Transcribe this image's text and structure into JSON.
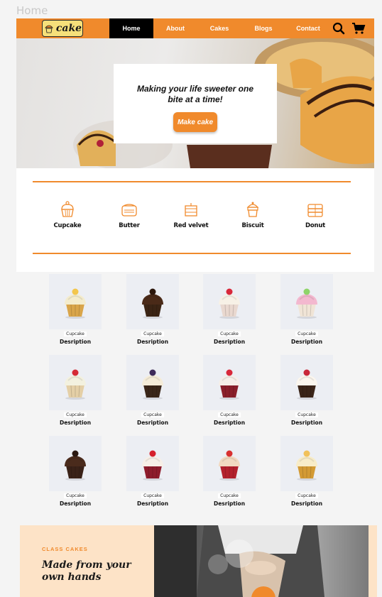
{
  "page_label": "Home",
  "brand": {
    "logo_text": "cake"
  },
  "nav": {
    "items": [
      {
        "label": "Home",
        "active": true
      },
      {
        "label": "About",
        "active": false
      },
      {
        "label": "Cakes",
        "active": false
      },
      {
        "label": "Blogs",
        "active": false
      },
      {
        "label": "Contact",
        "active": false
      }
    ],
    "icons": [
      "search-icon",
      "cart-icon"
    ]
  },
  "hero": {
    "title": "Making your life sweeter one bite at a time!",
    "button_label": "Make cake"
  },
  "categories": [
    {
      "label": "Cupcake",
      "icon": "cupcake-icon"
    },
    {
      "label": "Butter",
      "icon": "butter-icon"
    },
    {
      "label": "Red velvet",
      "icon": "red-velvet-icon"
    },
    {
      "label": "Biscuit",
      "icon": "biscuit-icon"
    },
    {
      "label": "Donut",
      "icon": "donut-icon"
    }
  ],
  "products": [
    {
      "name": "Cupcake",
      "desc": "Desription",
      "frosting": "#f4eccd",
      "wrapper": "#d9a54a",
      "topping": "#f3c64c"
    },
    {
      "name": "Cupcake",
      "desc": "Desription",
      "frosting": "#4a2a18",
      "wrapper": "#3b2414",
      "topping": "#2c170c"
    },
    {
      "name": "Cupcake",
      "desc": "Desription",
      "frosting": "#f7f1e6",
      "wrapper": "#e9d8cf",
      "topping": "#d8283a"
    },
    {
      "name": "Cupcake",
      "desc": "Desription",
      "frosting": "#f3b8cf",
      "wrapper": "#f0e4d6",
      "topping": "#8fd46a"
    },
    {
      "name": "Cupcake",
      "desc": "Desription",
      "frosting": "#f3f1df",
      "wrapper": "#e4cfa6",
      "topping": "#d52b36"
    },
    {
      "name": "Cupcake",
      "desc": "Desription",
      "frosting": "#f5ecd8",
      "wrapper": "#3a2618",
      "topping": "#3e2b5a"
    },
    {
      "name": "Cupcake",
      "desc": "Desription",
      "frosting": "#f6efe8",
      "wrapper": "#8a1f2a",
      "topping": "#d8283a"
    },
    {
      "name": "Cupcake",
      "desc": "Desription",
      "frosting": "#fbf6ee",
      "wrapper": "#3a2418",
      "topping": "#c9283a"
    },
    {
      "name": "Cupcake",
      "desc": "Desription",
      "frosting": "#4a2b1c",
      "wrapper": "#3a2218",
      "topping": "#2a1810"
    },
    {
      "name": "Cupcake",
      "desc": "Desription",
      "frosting": "#f7efe7",
      "wrapper": "#8e1c2c",
      "topping": "#d5202c"
    },
    {
      "name": "Cupcake",
      "desc": "Desription",
      "frosting": "#f2d9c0",
      "wrapper": "#b3202c",
      "topping": "#d83030"
    },
    {
      "name": "Cupcake",
      "desc": "Desription",
      "frosting": "#f8ecc8",
      "wrapper": "#d39a34",
      "topping": "#f1c15a"
    }
  ],
  "class_section": {
    "label": "CLASS CAKES",
    "title": "Made from your own hands"
  },
  "colors": {
    "accent": "#f08a2c",
    "nav_active": "#000000",
    "card_bg": "#eceef3",
    "class_bg": "#fde3c7"
  }
}
